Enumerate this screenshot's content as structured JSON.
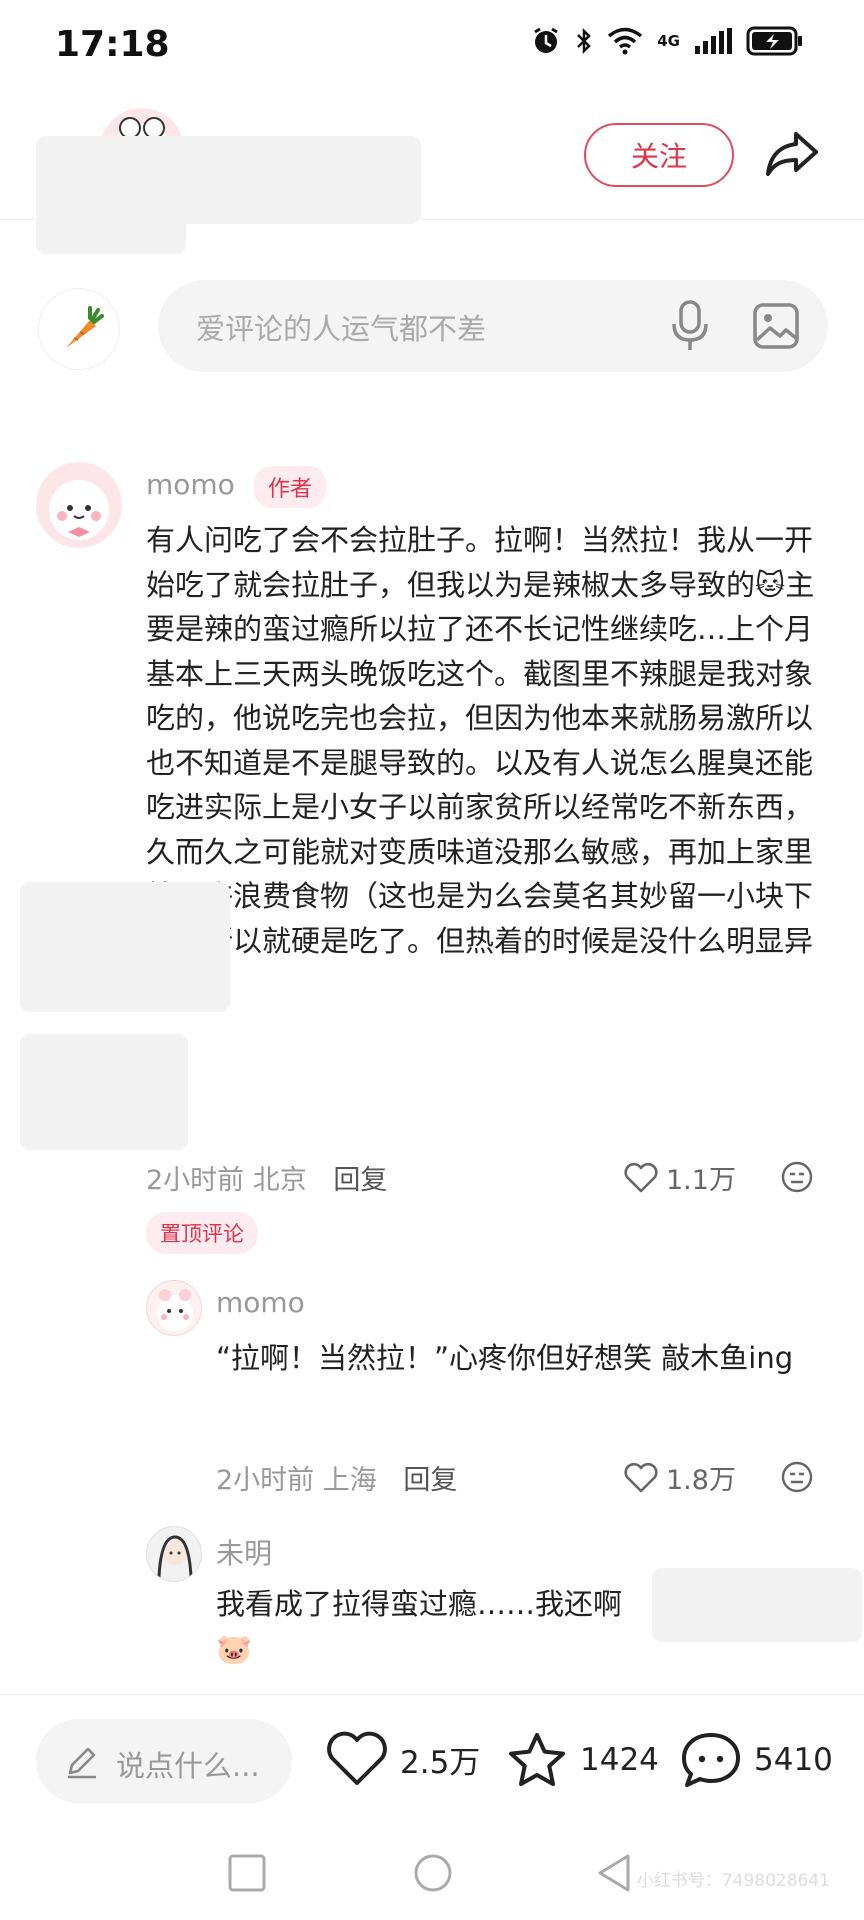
{
  "status_bar": {
    "time": "17:18",
    "network": "4G"
  },
  "header": {
    "follow_label": "关注"
  },
  "comment_input": {
    "placeholder": "爱评论的人运气都不差"
  },
  "comments": [
    {
      "name": "momo",
      "tag": "作者",
      "text": "有人问吃了会不会拉肚子。拉啊！当然拉！我从一开始吃了就会拉肚子，但我以为是辣椒太多导致的🐱主要是辣的蛮过瘾所以拉了还不长记性继续吃…上个月基本上三天两头晚饭吃这个。截图里不辣腿是我对象吃的，他说吃完也会拉，但因为他本来就肠易激所以也不知道是不是腿导致的。以及有人说怎么腥臭还能吃进实际上是小女子以前家贫所以经常吃不新东西，久而久之可能就对变质味道没那么敏感，再加上家里教不许浪费食物（这也是为么会莫名其妙留一小块下来）所以就硬是吃了。但热着的时候是没什么明显异味的。",
      "time": "2小时前",
      "location": "北京",
      "reply": "回复",
      "likes": "1.1万",
      "pinned": "置顶评论"
    },
    {
      "name": "momo",
      "text": "“拉啊！当然拉！”心疼你但好想笑 敲木鱼ing",
      "time": "2小时前",
      "location": "上海",
      "reply": "回复",
      "likes": "1.8万"
    },
    {
      "name": "未明",
      "text": "我看成了拉得蛮过瘾……我还啊🐷"
    }
  ],
  "bottom_bar": {
    "say_placeholder": "说点什么...",
    "likes": "2.5万",
    "favorites": "1424",
    "comments": "5410"
  },
  "watermark": "小红书号：7498028641",
  "colors": {
    "accent": "#e0334a",
    "tag_bg": "#fdecef",
    "muted": "#999999"
  }
}
